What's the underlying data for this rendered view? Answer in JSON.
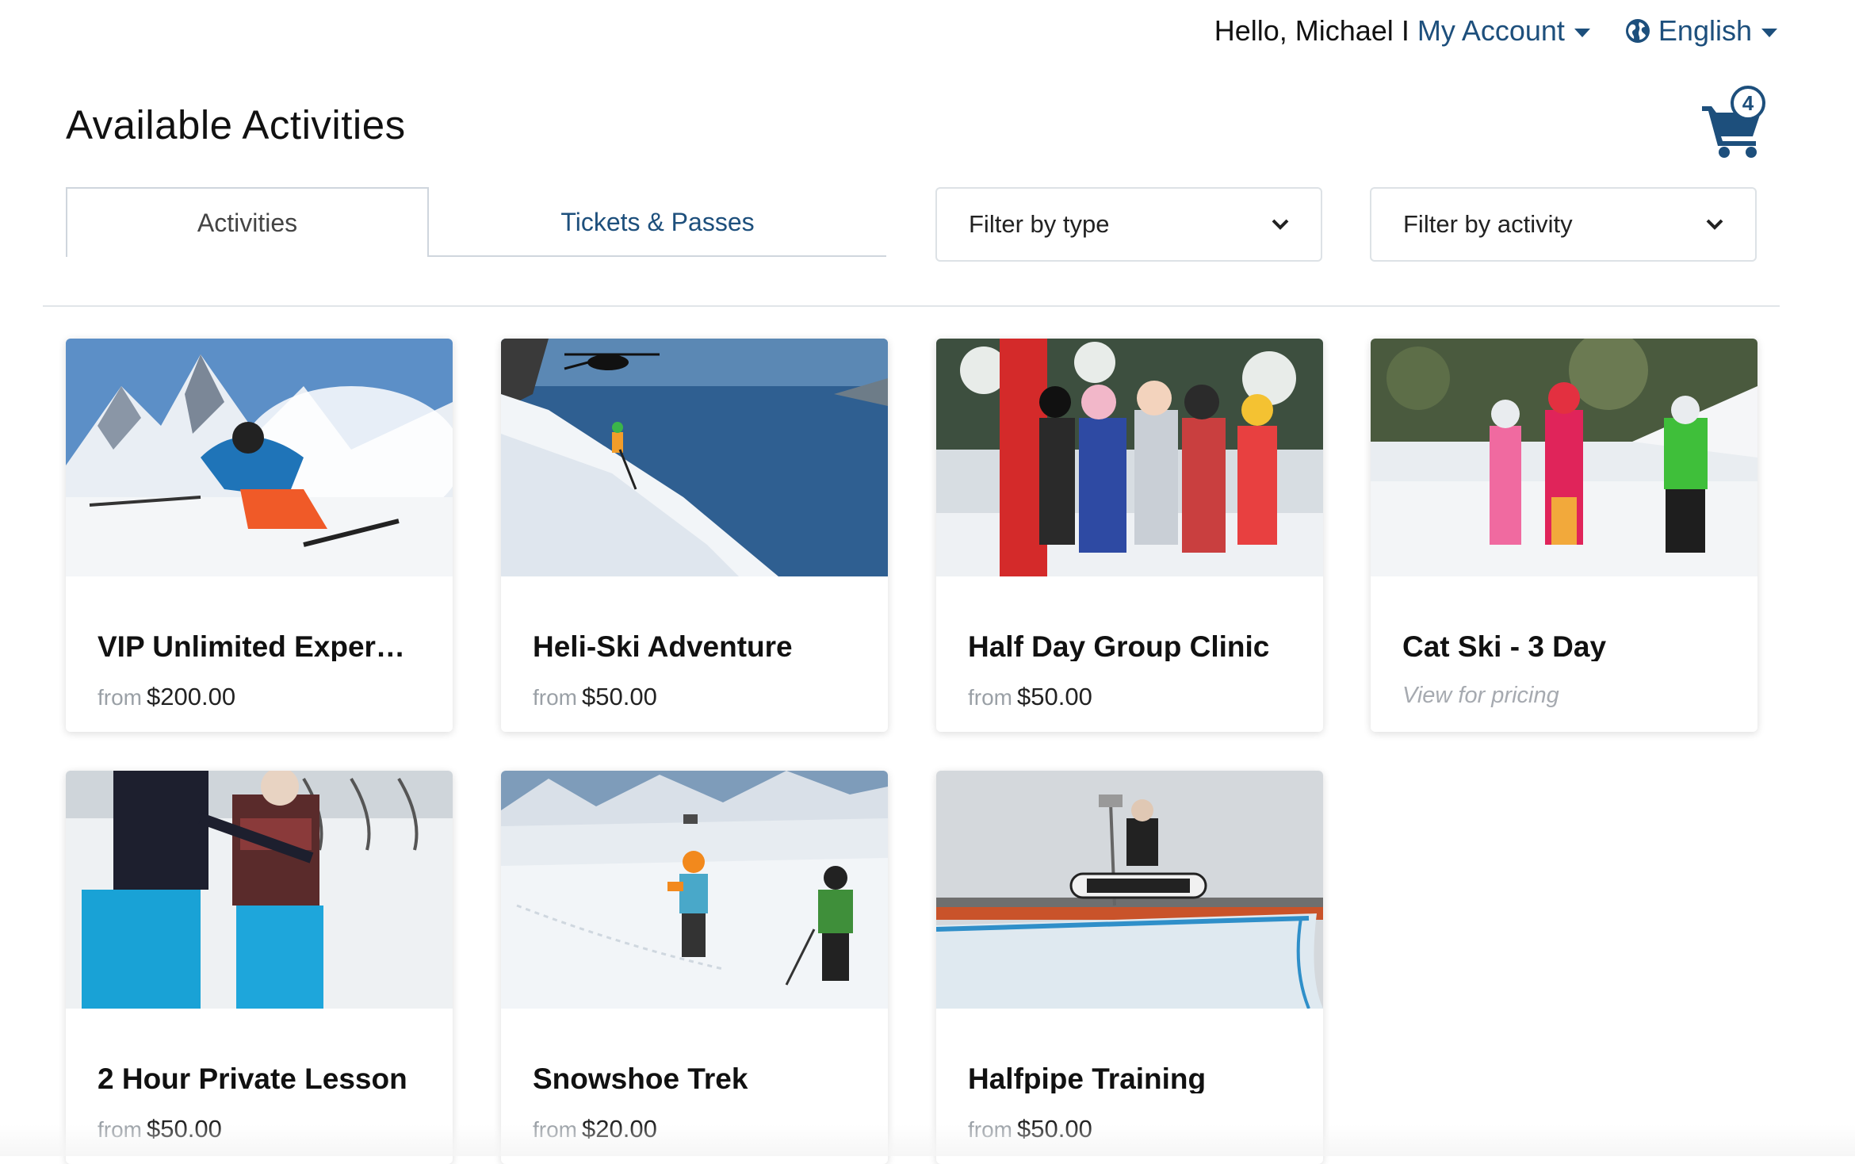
{
  "header": {
    "greeting": "Hello, Michael",
    "separator": "I",
    "account_label": "My Account",
    "language_label": "English",
    "cart_count": "4",
    "accent_color": "#1d4f7c"
  },
  "page": {
    "title": "Available Activities"
  },
  "tabs": [
    {
      "label": "Activities",
      "active": true
    },
    {
      "label": "Tickets & Passes",
      "active": false
    }
  ],
  "filters": {
    "type_label": "Filter by type",
    "activity_label": "Filter by activity"
  },
  "activities": [
    {
      "title": "VIP Unlimited Exper…",
      "from": "from",
      "price": "$200.00",
      "image": "skier-powder-mountain"
    },
    {
      "title": "Heli-Ski Adventure",
      "from": "from",
      "price": "$50.00",
      "image": "helicopter-slope-sea"
    },
    {
      "title": "Half Day Group Clinic",
      "from": "from",
      "price": "$50.00",
      "image": "kids-ski-group"
    },
    {
      "title": "Cat Ski - 3 Day",
      "note": "View for pricing",
      "image": "kids-instructor-snow"
    },
    {
      "title": "2 Hour Private Lesson",
      "from": "from",
      "price": "$50.00",
      "image": "snowboard-lesson"
    },
    {
      "title": "Snowshoe Trek",
      "from": "from",
      "price": "$20.00",
      "image": "snowshoe-hikers"
    },
    {
      "title": "Halfpipe Training",
      "from": "from",
      "price": "$50.00",
      "image": "halfpipe-snowboarder"
    }
  ]
}
